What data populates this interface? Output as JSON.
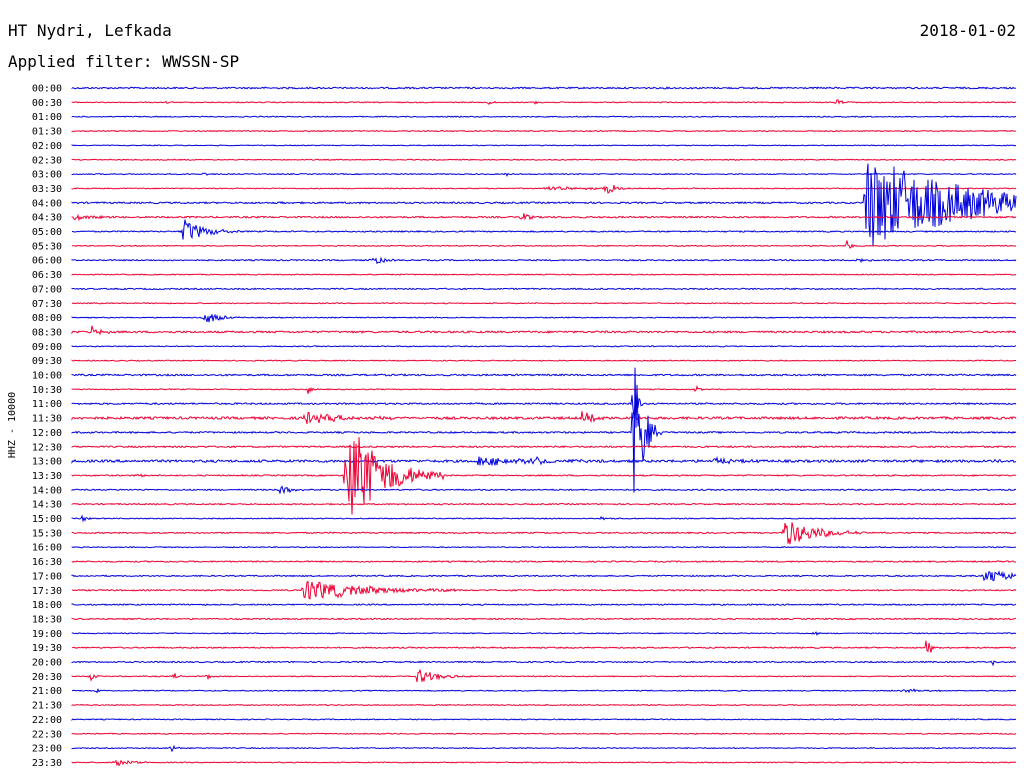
{
  "header": {
    "station": "HT Nydri, Lefkada",
    "date": "2018-01-02",
    "filter": "Applied filter: WWSSN-SP"
  },
  "colors": {
    "blue_trace": "#0000dd",
    "red_trace": "#ee0033"
  },
  "chart_data": {
    "type": "line",
    "ylabel": "HHZ - 10000",
    "row_labels": [
      "00:00",
      "00:30",
      "01:00",
      "01:30",
      "02:00",
      "02:30",
      "03:00",
      "03:30",
      "04:00",
      "04:30",
      "05:00",
      "05:30",
      "06:00",
      "06:30",
      "07:00",
      "07:30",
      "08:00",
      "08:30",
      "09:00",
      "09:30",
      "10:00",
      "10:30",
      "11:00",
      "11:30",
      "12:00",
      "12:30",
      "13:00",
      "13:30",
      "14:00",
      "14:30",
      "15:00",
      "15:30",
      "16:00",
      "16:30",
      "17:00",
      "17:30",
      "18:00",
      "18:30",
      "19:00",
      "19:30",
      "20:00",
      "20:30",
      "21:00",
      "21:30",
      "22:00",
      "22:30",
      "23:00",
      "23:30"
    ],
    "row_colors": [
      "blue",
      "red"
    ],
    "noise_levels": [
      1,
      0.6,
      0.6,
      0.6,
      0.5,
      0.6,
      0.6,
      0.6,
      1,
      1,
      0.8,
      0.6,
      0.8,
      0.6,
      0.8,
      0.6,
      0.6,
      1.2,
      0.6,
      0.6,
      1,
      0.6,
      1,
      1.5,
      1,
      1,
      1.5,
      0.8,
      0.8,
      0.8,
      0.6,
      0.8,
      0.6,
      0.8,
      0.8,
      0.8,
      0.8,
      0.8,
      0.6,
      0.8,
      0.8,
      0.6,
      0.6,
      0.6,
      0.6,
      0.6,
      0.6,
      0.6
    ],
    "events": [
      {
        "row": 1,
        "t": 0.1,
        "amp": 2,
        "dur": 0.003
      },
      {
        "row": 1,
        "t": 0.44,
        "amp": 4,
        "dur": 0.004
      },
      {
        "row": 1,
        "t": 0.49,
        "amp": 2,
        "dur": 0.004
      },
      {
        "row": 1,
        "t": 0.81,
        "amp": 3,
        "dur": 0.008
      },
      {
        "row": 6,
        "t": 0.14,
        "amp": 3,
        "dur": 0.003
      },
      {
        "row": 6,
        "t": 0.46,
        "amp": 3,
        "dur": 0.003
      },
      {
        "row": 7,
        "t": 0.5,
        "amp": 2,
        "dur": 0.05
      },
      {
        "row": 7,
        "t": 0.565,
        "amp": 8,
        "dur": 0.01
      },
      {
        "row": 8,
        "t": 0.22,
        "amp": 2,
        "dur": 0.004
      },
      {
        "row": 8,
        "t": 0.84,
        "amp": 50,
        "dur": 0.1
      },
      {
        "row": 9,
        "t": 0.0,
        "amp": 3,
        "dur": 0.02
      },
      {
        "row": 9,
        "t": 0.475,
        "amp": 8,
        "dur": 0.006
      },
      {
        "row": 10,
        "t": 0.117,
        "amp": 14,
        "dur": 0.02
      },
      {
        "row": 11,
        "t": 0.82,
        "amp": 9,
        "dur": 0.004
      },
      {
        "row": 12,
        "t": 0.317,
        "amp": 6,
        "dur": 0.01
      },
      {
        "row": 12,
        "t": 0.83,
        "amp": 3,
        "dur": 0.01
      },
      {
        "row": 16,
        "t": 0.14,
        "amp": 7,
        "dur": 0.015
      },
      {
        "row": 17,
        "t": 0.02,
        "amp": 6,
        "dur": 0.01
      },
      {
        "row": 21,
        "t": 0.25,
        "amp": 5,
        "dur": 0.004
      },
      {
        "row": 21,
        "t": 0.66,
        "amp": 7,
        "dur": 0.004
      },
      {
        "row": 22,
        "t": 0.595,
        "amp": 42,
        "dur": 0.003
      },
      {
        "row": 23,
        "t": 0.245,
        "amp": 6,
        "dur": 0.04
      },
      {
        "row": 23,
        "t": 0.54,
        "amp": 6,
        "dur": 0.015
      },
      {
        "row": 24,
        "t": 0.595,
        "amp": 80,
        "dur": 0.01
      },
      {
        "row": 26,
        "t": 0.43,
        "amp": 5,
        "dur": 0.05
      },
      {
        "row": 26,
        "t": 0.49,
        "amp": 6,
        "dur": 0.01
      },
      {
        "row": 26,
        "t": 0.68,
        "amp": 4,
        "dur": 0.02
      },
      {
        "row": 26,
        "t": 0.975,
        "amp": 3,
        "dur": 0.005
      },
      {
        "row": 27,
        "t": 0.29,
        "amp": 58,
        "dur": 0.035
      },
      {
        "row": 27,
        "t": 0.07,
        "amp": 3,
        "dur": 0.005
      },
      {
        "row": 28,
        "t": 0.22,
        "amp": 5,
        "dur": 0.01
      },
      {
        "row": 30,
        "t": 0.01,
        "amp": 3,
        "dur": 0.005
      },
      {
        "row": 30,
        "t": 0.56,
        "amp": 2,
        "dur": 0.01
      },
      {
        "row": 31,
        "t": 0.755,
        "amp": 15,
        "dur": 0.03
      },
      {
        "row": 34,
        "t": 0.965,
        "amp": 8,
        "dur": 0.03
      },
      {
        "row": 35,
        "t": 0.245,
        "amp": 12,
        "dur": 0.06
      },
      {
        "row": 35,
        "t": 0.665,
        "amp": 3,
        "dur": 0.004
      },
      {
        "row": 38,
        "t": 0.785,
        "amp": 3,
        "dur": 0.005
      },
      {
        "row": 39,
        "t": 0.905,
        "amp": 28,
        "dur": 0.003
      },
      {
        "row": 40,
        "t": 0.975,
        "amp": 4,
        "dur": 0.003
      },
      {
        "row": 41,
        "t": 0.02,
        "amp": 6,
        "dur": 0.003
      },
      {
        "row": 41,
        "t": 0.107,
        "amp": 7,
        "dur": 0.003
      },
      {
        "row": 41,
        "t": 0.142,
        "amp": 5,
        "dur": 0.003
      },
      {
        "row": 41,
        "t": 0.365,
        "amp": 8,
        "dur": 0.02
      },
      {
        "row": 42,
        "t": 0.026,
        "amp": 3,
        "dur": 0.003
      },
      {
        "row": 42,
        "t": 0.88,
        "amp": 2,
        "dur": 0.02
      },
      {
        "row": 46,
        "t": 0.105,
        "amp": 5,
        "dur": 0.006
      },
      {
        "row": 47,
        "t": 0.045,
        "amp": 5,
        "dur": 0.015
      }
    ]
  }
}
